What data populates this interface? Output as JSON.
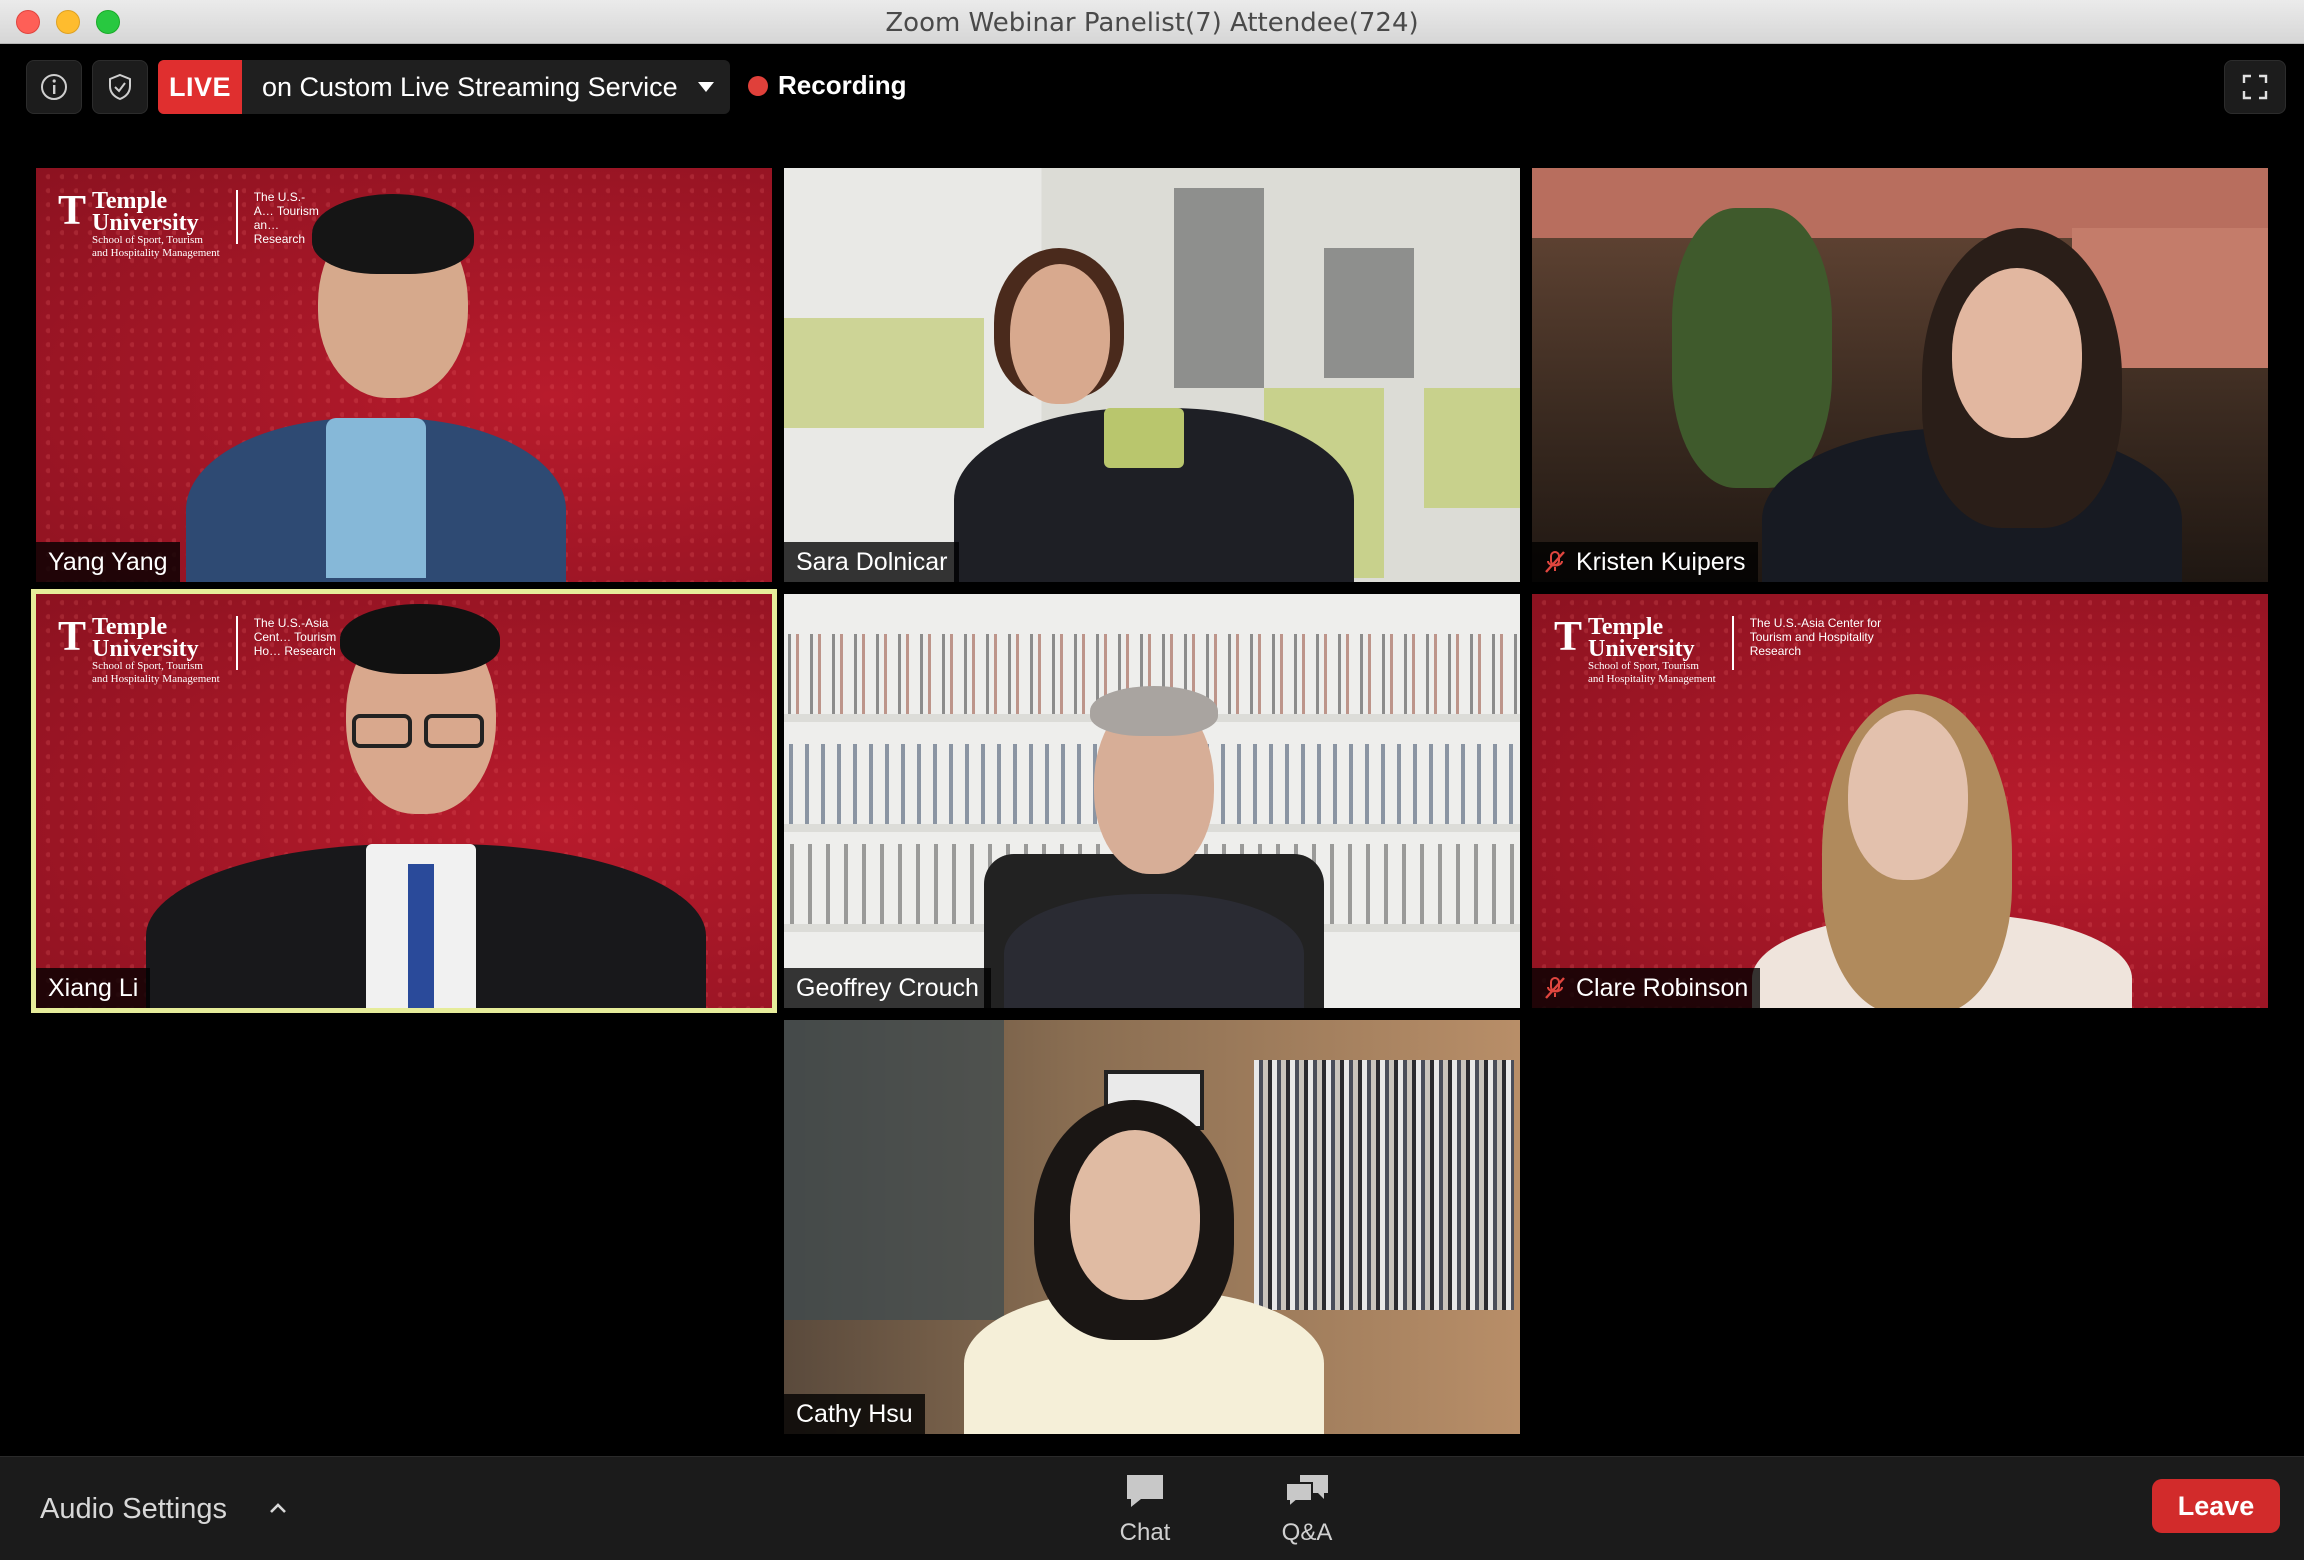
{
  "window": {
    "title": "Zoom Webinar Panelist(7)  Attendee(724)"
  },
  "toolbar": {
    "live_badge": "LIVE",
    "stream_label": "on Custom Live Streaming Service",
    "recording_label": "Recording"
  },
  "tiles": [
    {
      "name": "Yang Yang",
      "muted": false,
      "active": false
    },
    {
      "name": "Sara Dolnicar",
      "muted": false,
      "active": false
    },
    {
      "name": "Kristen Kuipers",
      "muted": true,
      "active": false
    },
    {
      "name": "Xiang Li",
      "muted": false,
      "active": true
    },
    {
      "name": "Geoffrey Crouch",
      "muted": false,
      "active": false
    },
    {
      "name": "Clare Robinson",
      "muted": true,
      "active": false
    },
    {
      "name": "Cathy Hsu",
      "muted": false,
      "active": false
    }
  ],
  "background_logo": {
    "line1": "Temple",
    "line2": "University",
    "line3": "School of Sport, Tourism",
    "line4": "and Hospitality Management",
    "sub_full": "The U.S.-Asia Center for Tourism and Hospitality Research",
    "sub_tile1": "The U.S.-A… Tourism an… Research",
    "sub_tile4": "The U.S.-Asia Cent… Tourism and Ho… Research"
  },
  "bottombar": {
    "audio_settings": "Audio Settings",
    "chat_label": "Chat",
    "qa_label": "Q&A",
    "leave_label": "Leave"
  },
  "colors": {
    "live_red": "#e02f2f",
    "active_speaker_border": "#e6ec9a",
    "leave_red": "#d22b2b",
    "temple_red": "#a01626"
  },
  "icons": {
    "info": "info-icon",
    "security": "shield-check-icon",
    "recording": "recording-dot-icon",
    "fullscreen": "fullscreen-icon",
    "muted": "microphone-muted-icon",
    "chat": "chat-bubble-icon",
    "qa": "qa-bubbles-icon"
  }
}
